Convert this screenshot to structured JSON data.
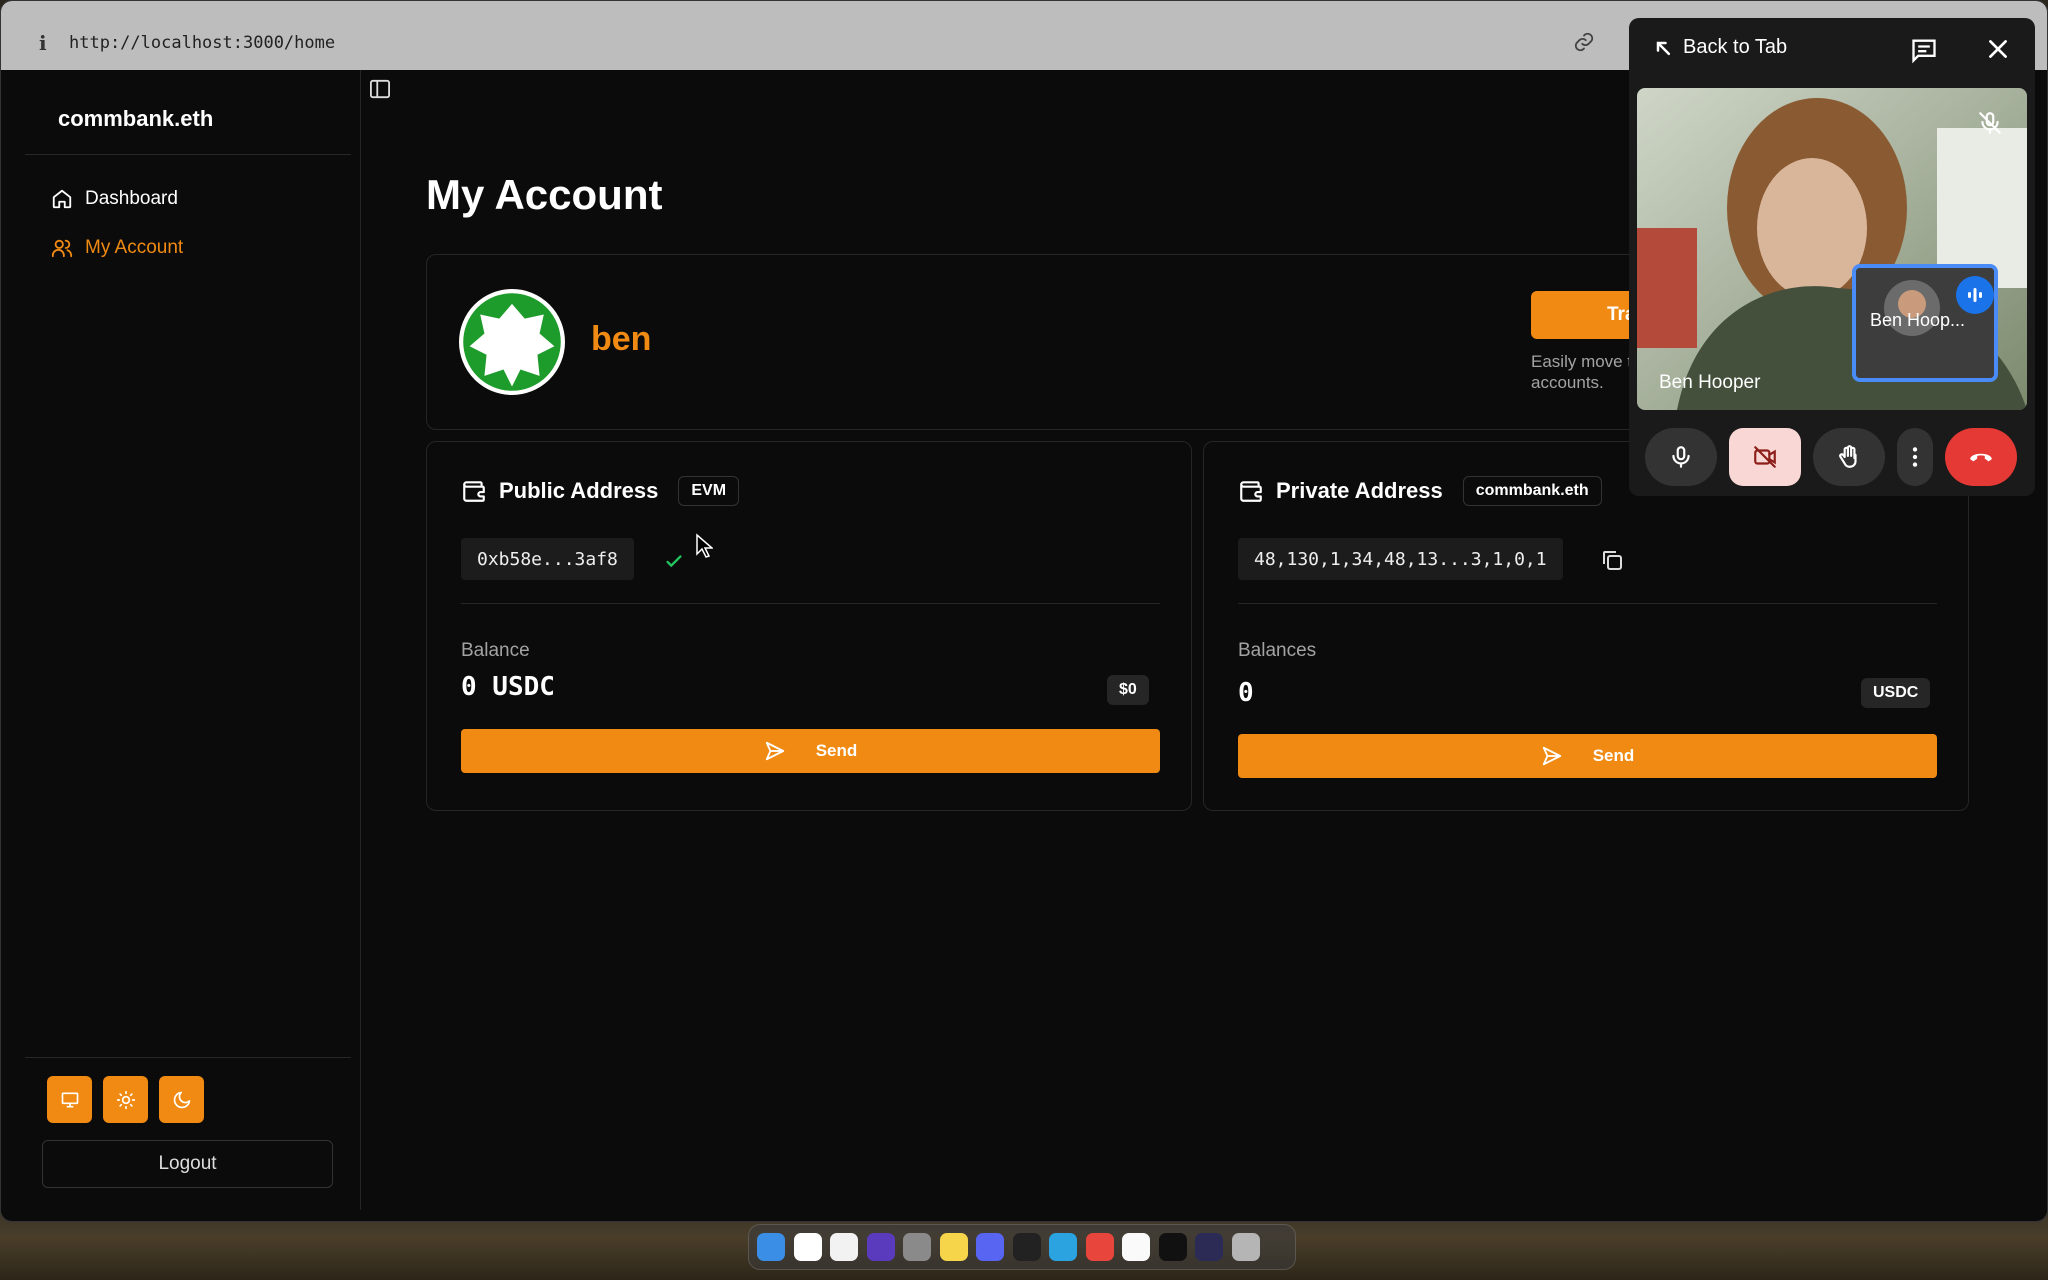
{
  "browser": {
    "info_icon": "i",
    "url": "http://localhost:3000/home"
  },
  "sidebar": {
    "brand": "commbank.eth",
    "items": [
      {
        "label": "Dashboard",
        "icon": "home-icon"
      },
      {
        "label": "My Account",
        "icon": "users-icon"
      }
    ],
    "theme_buttons": [
      "monitor-icon",
      "sun-icon",
      "moon-icon"
    ],
    "logout_label": "Logout"
  },
  "main": {
    "title": "My Account",
    "profile": {
      "username": "ben",
      "transfer_button": "Tra",
      "transfer_desc": "Easily move t accounts."
    },
    "public": {
      "title": "Public Address",
      "badge": "EVM",
      "address": "0xb58e...3af8",
      "balance_label": "Balance",
      "balance_value": "0 USDC",
      "balance_usd": "$0",
      "send_label": "Send"
    },
    "private": {
      "title": "Private Address",
      "badge": "commbank.eth",
      "address": "48,130,1,34,48,13...3,1,0,1",
      "balance_label": "Balances",
      "balance_value": "0",
      "token": "USDC",
      "send_label": "Send"
    }
  },
  "call": {
    "back_label": "Back to Tab",
    "main_participant": "Ben Hooper",
    "thumb_participant": "Ben Hoop...",
    "colors": {
      "end_call": "#e53935",
      "camera_off_bg": "#f9d7d5"
    }
  },
  "colors": {
    "accent": "#f08a12",
    "bg": "#0b0b0b",
    "border": "#262626"
  }
}
